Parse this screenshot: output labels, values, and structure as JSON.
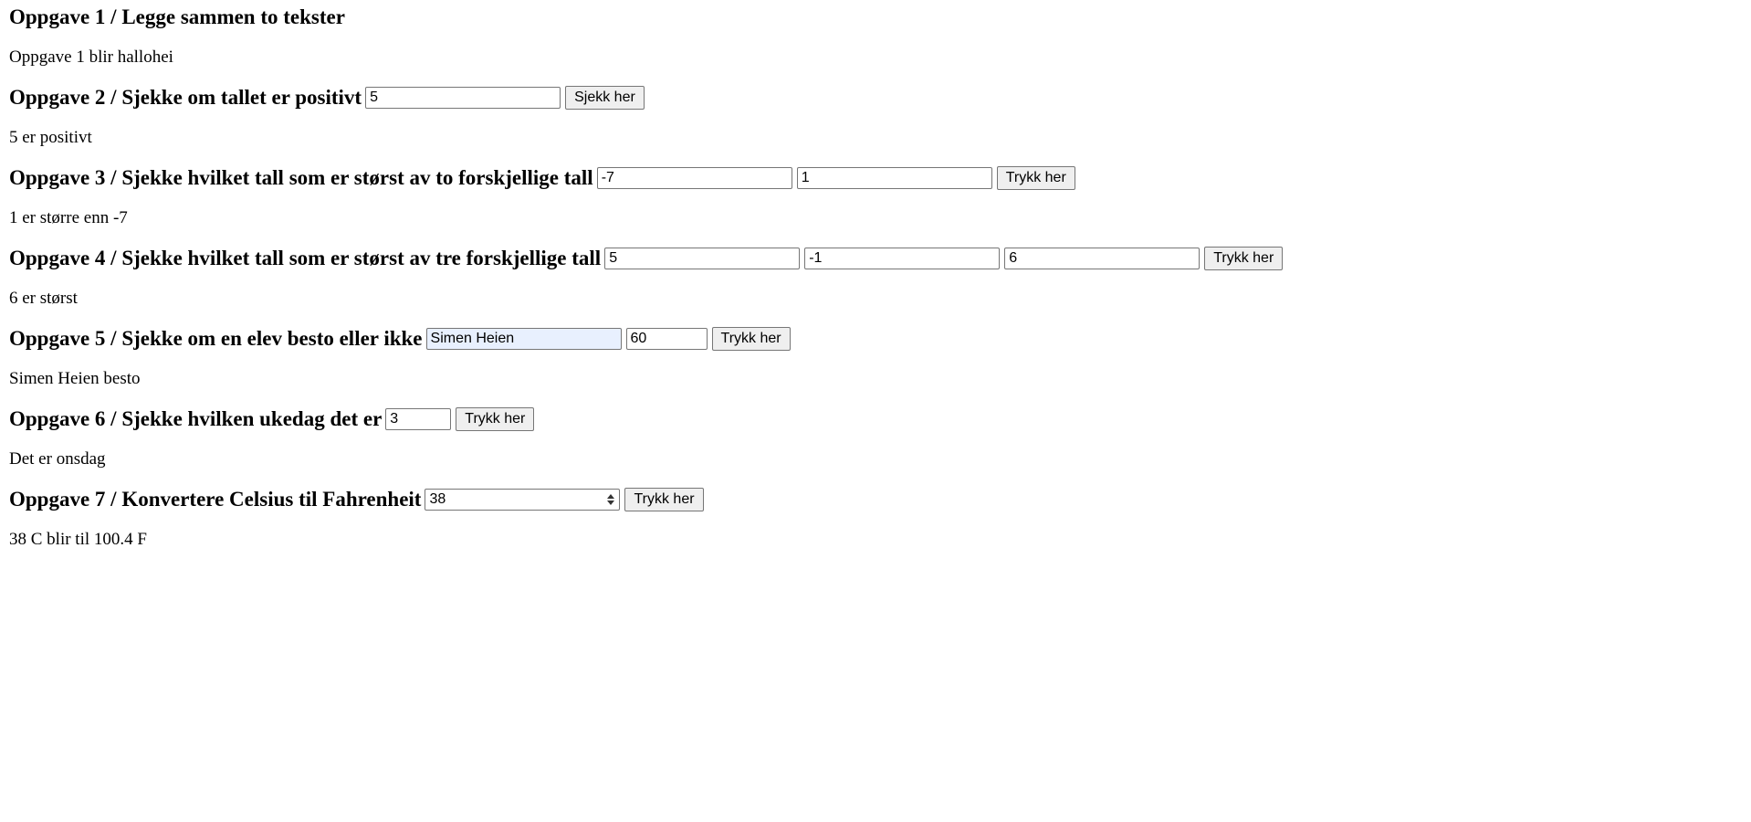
{
  "tasks": [
    {
      "title": "Oppgave 1 / Legge sammen to tekster",
      "result": "Oppgave 1 blir hallohei"
    },
    {
      "title": "Oppgave 2 / Sjekke om tallet er positivt",
      "inputs": [
        "5"
      ],
      "button": "Sjekk her",
      "result": "5 er positivt"
    },
    {
      "title": "Oppgave 3 / Sjekke hvilket tall som er størst av to forskjellige tall",
      "inputs": [
        "-7",
        "1"
      ],
      "button": "Trykk her",
      "result": "1 er større enn -7"
    },
    {
      "title": "Oppgave 4 / Sjekke hvilket tall som er størst av tre forskjellige tall",
      "inputs": [
        "5",
        "-1",
        "6"
      ],
      "button": "Trykk her",
      "result": "6 er størst"
    },
    {
      "title": "Oppgave 5 / Sjekke om en elev besto eller ikke",
      "inputs": [
        "Simen Heien",
        "60"
      ],
      "button": "Trykk her",
      "result": "Simen Heien besto"
    },
    {
      "title": "Oppgave 6 / Sjekke hvilken ukedag det er",
      "inputs": [
        "3"
      ],
      "button": "Trykk her",
      "result": "Det er onsdag"
    },
    {
      "title": "Oppgave 7 / Konvertere Celsius til Fahrenheit",
      "inputs": [
        "38"
      ],
      "button": "Trykk her",
      "result": "38 C blir til 100.4 F"
    }
  ],
  "colors": {
    "autofill_background": "#e8f0fe",
    "button_background": "#efefef"
  }
}
